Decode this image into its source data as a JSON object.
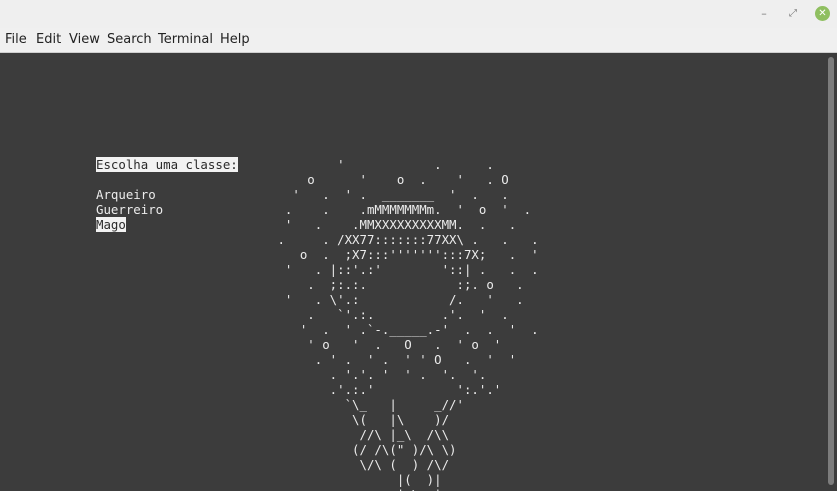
{
  "window": {
    "controls": {
      "minimize": "–",
      "maximize": "⤢",
      "close": "✕"
    }
  },
  "menubar": {
    "items": [
      "File",
      "Edit",
      "View",
      "Search",
      "Terminal",
      "Help"
    ]
  },
  "terminal": {
    "prompt": "Escolha uma classe:",
    "options": [
      "Arqueiro",
      "Guerreiro",
      "Mago"
    ],
    "selected_option": "Mago",
    "ascii_art": "         '            .      .\n     o      '    o  .    '   . O\n   '   .  ' .  _______  '  .   .\n  .    .    .mMMMMMMMm.  '  o  '  .\n  '   .    .MMXXXXXXXXXMM.  .   .\n .     . /XX77:::::::77XX\\ .   .   .\n    o  .  ;X7:::''''''':::7X;   .  '\n  '   . |::'.:'        '::| .   .  .\n     .  ;:.:.            :;. o   .\n  '   . \\'.:            /.   '   .\n     .   `'.:.         .'.  '  .\n    '  .  ' .`-._____.-'  .  .  '  .\n     ' o   '  .   O   .  ' o  '\n      . ' .  ' .  ' ' O   .  '  '\n        . '.'. '  ' .  '.  '.\n        .'.:.'           ':.'.'\n          `\\_   |     _//'\n           \\(   |\\    )/\n            //\\ |_\\  /\\\\\n           (/ /\\(\" )/\\ \\)\n            \\/\\ (  ) /\\/\n                 |(  )|\n                 | \\  |"
  },
  "colors": {
    "terminal_bg": "#3c3c3c",
    "text": "#ececec",
    "highlight_bg": "#f2f2f2",
    "close_button": "#8fbf60"
  }
}
